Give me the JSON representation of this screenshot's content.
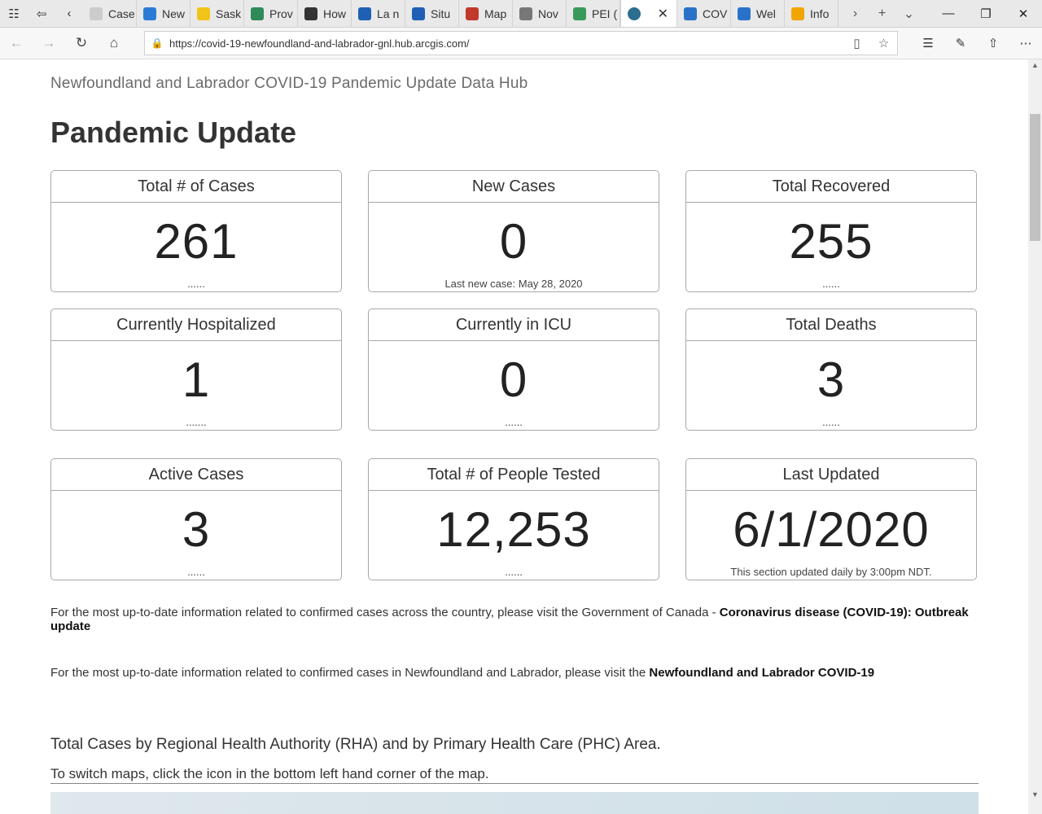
{
  "browser": {
    "tabs": [
      {
        "label": "Case",
        "icon": "document-icon",
        "color": "#cccccc"
      },
      {
        "label": "New",
        "icon": "chart-icon",
        "color": "#2b7bd6"
      },
      {
        "label": "Sask",
        "icon": "sask-icon",
        "color": "#f0c419"
      },
      {
        "label": "Prov",
        "icon": "prov-icon",
        "color": "#2e8b57"
      },
      {
        "label": "How",
        "icon": "shield-icon",
        "color": "#333333"
      },
      {
        "label": "La n",
        "icon": "fleur-de-lis-icon",
        "color": "#1f5fb5"
      },
      {
        "label": "Situ",
        "icon": "fleur-de-lis-icon",
        "color": "#1f5fb5"
      },
      {
        "label": "Map",
        "icon": "map-icon",
        "color": "#c0392b"
      },
      {
        "label": "Nov",
        "icon": "image-icon",
        "color": "#777777"
      },
      {
        "label": "PEI (",
        "icon": "pei-icon",
        "color": "#3a9a5b"
      },
      {
        "label": "",
        "icon": "globe-icon",
        "color": "#2c6e8f",
        "active": true
      },
      {
        "label": "COV",
        "icon": "cov-icon",
        "color": "#2a72c9"
      },
      {
        "label": "Wel",
        "icon": "wel-icon",
        "color": "#2a72c9"
      },
      {
        "label": "Info",
        "icon": "info-icon",
        "color": "#f0a500"
      }
    ],
    "url": "https://covid-19-newfoundland-and-labrador-gnl.hub.arcgis.com/"
  },
  "page": {
    "hub_title": "Newfoundland and Labrador COVID-19 Pandemic Update Data Hub",
    "title": "Pandemic Update",
    "cards": [
      {
        "label": "Total # of Cases",
        "value": "261",
        "footer": "......"
      },
      {
        "label": "New Cases",
        "value": "0",
        "footer": "Last new case: May 28, 2020"
      },
      {
        "label": "Total Recovered",
        "value": "255",
        "footer": "......"
      },
      {
        "label": "Currently Hospitalized",
        "value": "1",
        "footer": "......."
      },
      {
        "label": "Currently in ICU",
        "value": "0",
        "footer": "......"
      },
      {
        "label": "Total Deaths",
        "value": "3",
        "footer": "......"
      },
      {
        "label": "Active Cases",
        "value": "3",
        "footer": "......"
      },
      {
        "label": "Total # of People Tested",
        "value": "12,253",
        "footer": "......"
      },
      {
        "label": "Last Updated",
        "value": "6/1/2020",
        "footer": "This section updated daily by 3:00pm NDT."
      }
    ],
    "para1_text": "For the most up-to-date information related to confirmed cases across the country, please visit the Government of Canada - ",
    "para1_link": "Coronavirus disease (COVID-19): Outbreak update",
    "para2_text": "For the most up-to-date information related to confirmed cases in Newfoundland and Labrador, please visit the ",
    "para2_link": "Newfoundland and Labrador COVID-19",
    "section_heading": "Total Cases by Regional Health Authority (RHA) and by Primary Health Care (PHC) Area.",
    "section_sub": "To switch maps, click the icon in the bottom left hand corner of the map."
  }
}
